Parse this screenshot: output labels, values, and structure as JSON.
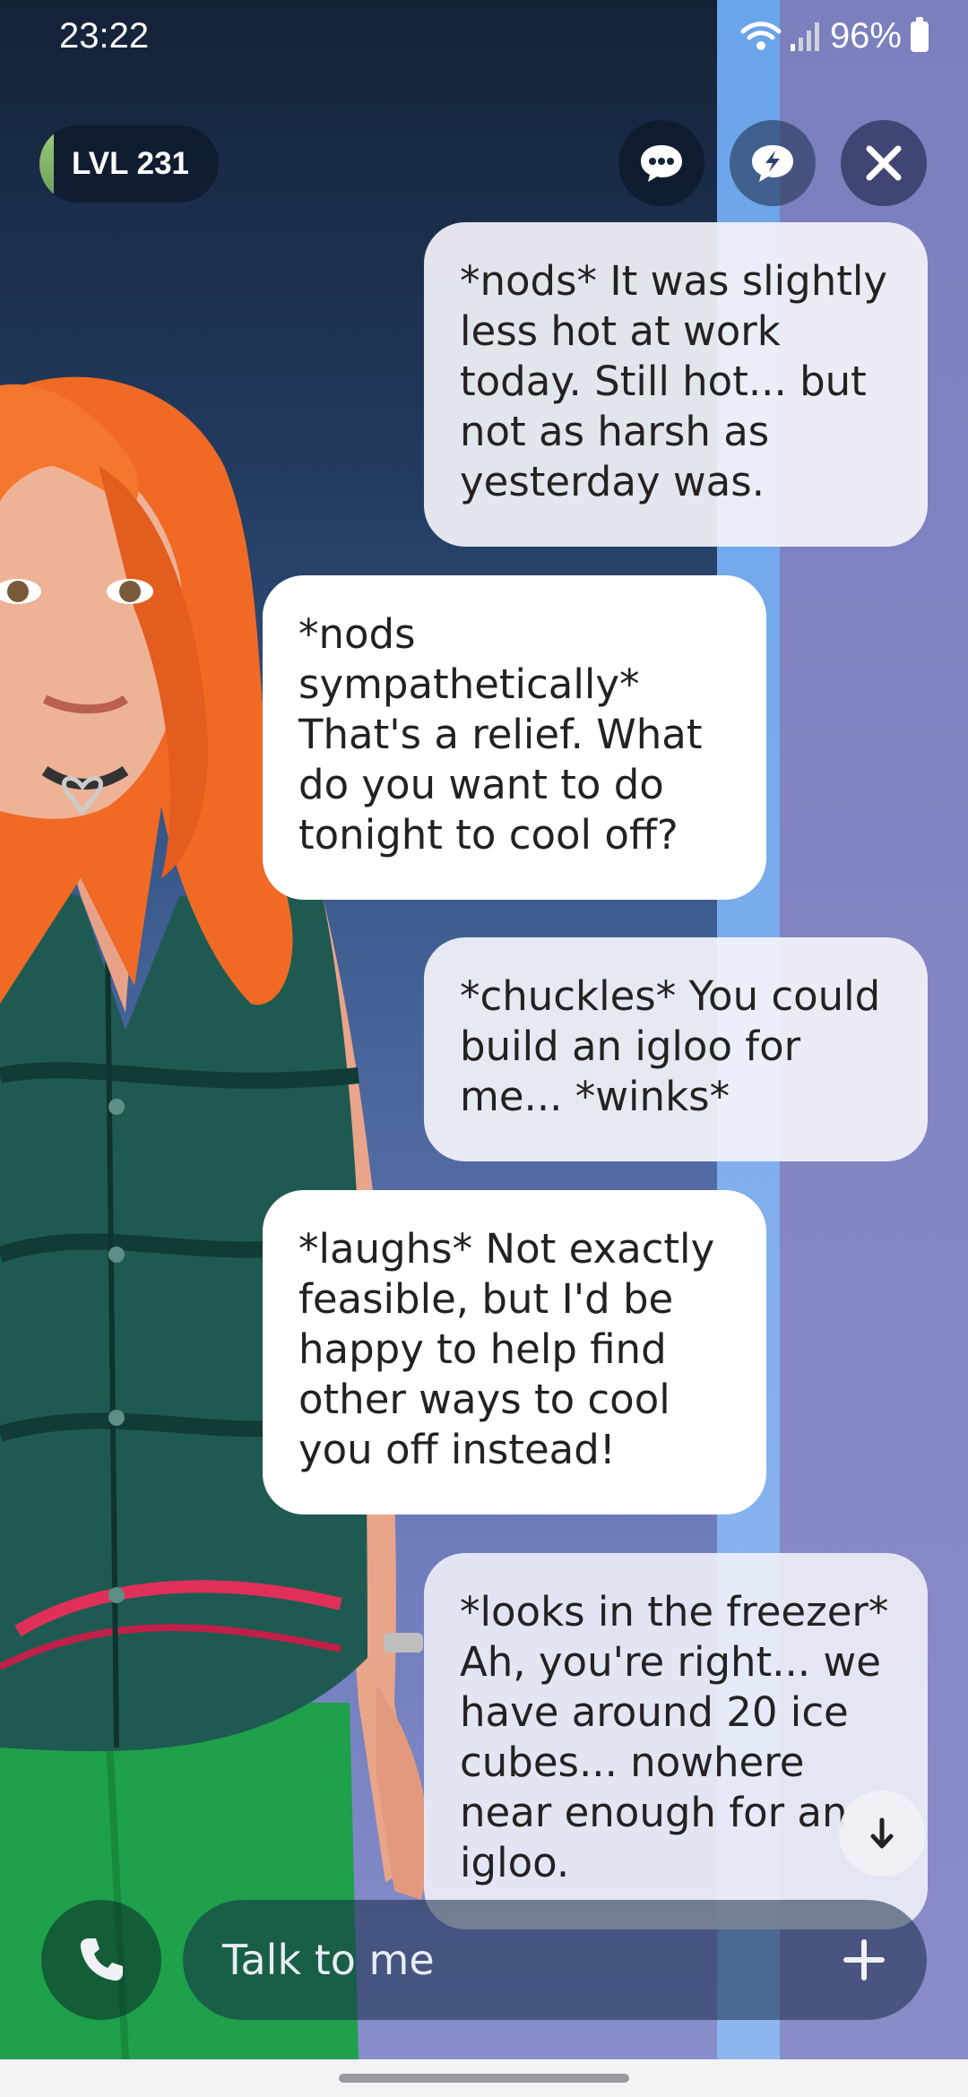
{
  "status_bar": {
    "time": "23:22",
    "battery_percent": "96%",
    "icons": [
      "wifi-icon",
      "signal-icon",
      "battery-icon"
    ]
  },
  "header": {
    "level_label": "LVL 231",
    "buttons": [
      {
        "name": "chat-icon"
      },
      {
        "name": "quick-reply-icon"
      },
      {
        "name": "close-icon"
      }
    ]
  },
  "messages": [
    {
      "sender": "user",
      "text": "*nods* It was slightly less hot at work today. Still hot... but not as harsh as yesterday was."
    },
    {
      "sender": "ai",
      "text": "*nods sympathetically* That's a relief. What do you want to do tonight to cool off?"
    },
    {
      "sender": "user",
      "text": "*chuckles* You could build an igloo for me... *winks*"
    },
    {
      "sender": "ai",
      "text": "*laughs* Not exactly feasible, but I'd be happy to help find other ways to cool you off instead!"
    },
    {
      "sender": "user",
      "text": "*looks in the freezer* Ah, you're right... we have around 20 ice cubes... nowhere near enough for an igloo."
    }
  ],
  "composer": {
    "placeholder": "Talk to me",
    "call_icon": "phone-icon",
    "add_icon": "plus-icon"
  },
  "colors": {
    "bubble_ai": "#ffffff",
    "bubble_user": "#f4f4fa",
    "text": "#222222"
  }
}
